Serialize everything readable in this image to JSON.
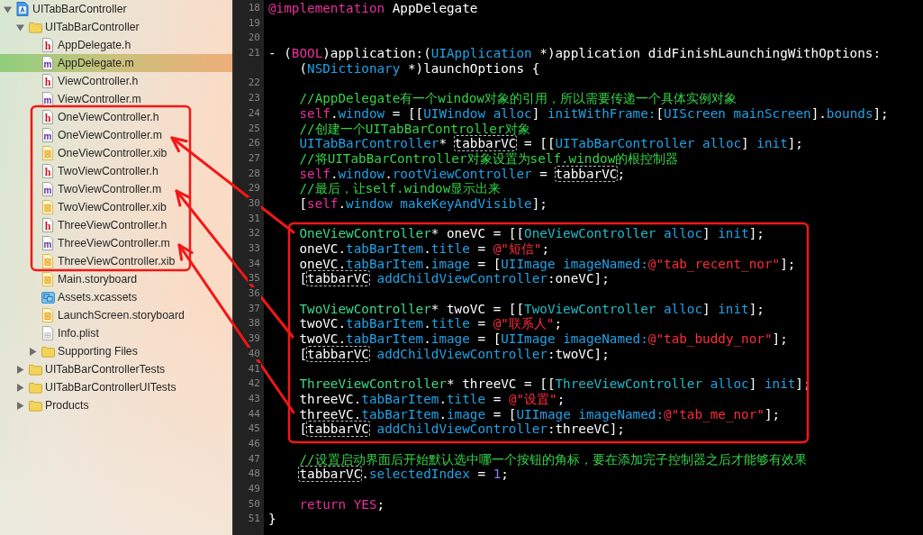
{
  "navigator": {
    "items": [
      {
        "name": "UITabBarController",
        "kind": "project",
        "expanded": true,
        "selected": false,
        "children": [
          {
            "name": "UITabBarController",
            "kind": "folder",
            "expanded": true,
            "selected": false,
            "children": [
              {
                "name": "AppDelegate.h",
                "kind": "header",
                "glyph": "h",
                "selected": false
              },
              {
                "name": "AppDelegate.m",
                "kind": "source",
                "glyph": "m",
                "selected": true
              },
              {
                "name": "ViewController.h",
                "kind": "header",
                "glyph": "h",
                "selected": false
              },
              {
                "name": "ViewController.m",
                "kind": "source",
                "glyph": "m",
                "selected": false
              },
              {
                "name": "OneViewController.h",
                "kind": "header",
                "glyph": "h",
                "selected": false
              },
              {
                "name": "OneViewController.m",
                "kind": "source",
                "glyph": "m",
                "selected": false
              },
              {
                "name": "OneViewController.xib",
                "kind": "interface",
                "selected": false
              },
              {
                "name": "TwoViewController.h",
                "kind": "header",
                "glyph": "h",
                "selected": false
              },
              {
                "name": "TwoViewController.m",
                "kind": "source",
                "glyph": "m",
                "selected": false
              },
              {
                "name": "TwoViewController.xib",
                "kind": "interface",
                "selected": false
              },
              {
                "name": "ThreeViewController.h",
                "kind": "header",
                "glyph": "h",
                "selected": false
              },
              {
                "name": "ThreeViewController.m",
                "kind": "source",
                "glyph": "m",
                "selected": false
              },
              {
                "name": "ThreeViewController.xib",
                "kind": "interface",
                "selected": false
              },
              {
                "name": "Main.storyboard",
                "kind": "interface",
                "selected": false
              },
              {
                "name": "Assets.xcassets",
                "kind": "assets",
                "selected": false
              },
              {
                "name": "LaunchScreen.storyboard",
                "kind": "interface",
                "selected": false
              },
              {
                "name": "Info.plist",
                "kind": "plist",
                "selected": false
              },
              {
                "name": "Supporting Files",
                "kind": "folder",
                "expanded": false,
                "selected": false
              }
            ]
          },
          {
            "name": "UITabBarControllerTests",
            "kind": "folder",
            "expanded": false,
            "selected": false
          },
          {
            "name": "UITabBarControllerUITests",
            "kind": "folder",
            "expanded": false,
            "selected": false
          },
          {
            "name": "Products",
            "kind": "folder",
            "expanded": false,
            "selected": false
          }
        ]
      }
    ]
  },
  "editor": {
    "lines": [
      {
        "number": "18",
        "segments": [
          {
            "text": "@implementation",
            "kind": "keyword"
          },
          {
            "text": " AppDelegate",
            "kind": "plain"
          }
        ]
      },
      {
        "number": "19"
      },
      {
        "number": "20"
      },
      {
        "number": "21",
        "segments": [
          {
            "text": "- (",
            "kind": "plain"
          },
          {
            "text": "BOOL",
            "kind": "keyword"
          },
          {
            "text": ")application:(",
            "kind": "plain"
          },
          {
            "text": "UIApplication",
            "kind": "api"
          },
          {
            "text": " *)application didFinishLaunchingWithOptions:",
            "kind": "plain"
          }
        ],
        "continuation": [
          {
            "text": "(",
            "kind": "plain"
          },
          {
            "text": "NSDictionary",
            "kind": "api"
          },
          {
            "text": " *)launchOptions {",
            "kind": "plain"
          }
        ]
      },
      {
        "number": "22"
      },
      {
        "number": "23",
        "segments": [
          {
            "text": "    //AppDelegate有一个window对象的引用，所以需要传递一个具体实例对象",
            "kind": "comment"
          }
        ]
      },
      {
        "number": "24",
        "segments": [
          {
            "text": "    self",
            "kind": "keyword"
          },
          {
            "text": ".",
            "kind": "plain"
          },
          {
            "text": "window",
            "kind": "api"
          },
          {
            "text": " = [[",
            "kind": "plain"
          },
          {
            "text": "UIWindow",
            "kind": "api"
          },
          {
            "text": " alloc",
            "kind": "api"
          },
          {
            "text": "] ",
            "kind": "plain"
          },
          {
            "text": "initWithFrame:",
            "kind": "api"
          },
          {
            "text": "[",
            "kind": "plain"
          },
          {
            "text": "UIScreen",
            "kind": "api"
          },
          {
            "text": " mainScreen",
            "kind": "api"
          },
          {
            "text": "].",
            "kind": "plain"
          },
          {
            "text": "bounds",
            "kind": "api"
          },
          {
            "text": "];",
            "kind": "plain"
          }
        ]
      },
      {
        "number": "25",
        "segments": [
          {
            "text": "    //创建一个UITabBarController对象",
            "kind": "comment"
          }
        ]
      },
      {
        "number": "26",
        "segments": [
          {
            "text": "    UITabBarController",
            "kind": "api"
          },
          {
            "text": "* ",
            "kind": "plain"
          },
          {
            "text": "tabbarVC",
            "kind": "occurrence"
          },
          {
            "text": " = [[",
            "kind": "plain"
          },
          {
            "text": "UITabBarController",
            "kind": "api"
          },
          {
            "text": " alloc",
            "kind": "api"
          },
          {
            "text": "] ",
            "kind": "plain"
          },
          {
            "text": "init",
            "kind": "api"
          },
          {
            "text": "];",
            "kind": "plain"
          }
        ]
      },
      {
        "number": "27",
        "segments": [
          {
            "text": "    //将UITabBarController对象设置为self.window的根控制器",
            "kind": "comment"
          }
        ]
      },
      {
        "number": "28",
        "segments": [
          {
            "text": "    self",
            "kind": "keyword"
          },
          {
            "text": ".",
            "kind": "plain"
          },
          {
            "text": "window",
            "kind": "api"
          },
          {
            "text": ".",
            "kind": "plain"
          },
          {
            "text": "rootViewController",
            "kind": "api"
          },
          {
            "text": " = ",
            "kind": "plain"
          },
          {
            "text": "tabbarVC",
            "kind": "occurrence"
          },
          {
            "text": ";",
            "kind": "plain"
          }
        ]
      },
      {
        "number": "29",
        "segments": [
          {
            "text": "    //最后，让self.window显示出来",
            "kind": "comment"
          }
        ]
      },
      {
        "number": "30",
        "segments": [
          {
            "text": "    [",
            "kind": "plain"
          },
          {
            "text": "self",
            "kind": "keyword"
          },
          {
            "text": ".",
            "kind": "plain"
          },
          {
            "text": "window",
            "kind": "api"
          },
          {
            "text": " makeKeyAndVisible",
            "kind": "api"
          },
          {
            "text": "];",
            "kind": "plain"
          }
        ]
      },
      {
        "number": "31"
      },
      {
        "number": "32",
        "segments": [
          {
            "text": "    OneViewController",
            "kind": "project"
          },
          {
            "text": "* oneVC = [[",
            "kind": "plain"
          },
          {
            "text": "OneViewController",
            "kind": "project_ref"
          },
          {
            "text": " alloc",
            "kind": "api"
          },
          {
            "text": "] ",
            "kind": "plain"
          },
          {
            "text": "init",
            "kind": "api"
          },
          {
            "text": "];",
            "kind": "plain"
          }
        ]
      },
      {
        "number": "33",
        "segments": [
          {
            "text": "    oneVC.",
            "kind": "plain"
          },
          {
            "text": "tabBarItem",
            "kind": "api"
          },
          {
            "text": ".",
            "kind": "plain"
          },
          {
            "text": "title",
            "kind": "api"
          },
          {
            "text": " = ",
            "kind": "plain"
          },
          {
            "text": "@\"短信\"",
            "kind": "string"
          },
          {
            "text": ";",
            "kind": "plain"
          }
        ]
      },
      {
        "number": "34",
        "segments": [
          {
            "text": "    oneVC.",
            "kind": "plain"
          },
          {
            "text": "tabBarItem",
            "kind": "api"
          },
          {
            "text": ".",
            "kind": "plain"
          },
          {
            "text": "image",
            "kind": "api"
          },
          {
            "text": " = [",
            "kind": "plain"
          },
          {
            "text": "UIImage",
            "kind": "api"
          },
          {
            "text": " imageNamed:",
            "kind": "api"
          },
          {
            "text": "@\"tab_recent_nor\"",
            "kind": "string"
          },
          {
            "text": "];",
            "kind": "plain"
          }
        ]
      },
      {
        "number": "35",
        "segments": [
          {
            "text": "    [",
            "kind": "plain"
          },
          {
            "text": "tabbarVC",
            "kind": "occurrence"
          },
          {
            "text": " addChildViewController",
            "kind": "api"
          },
          {
            "text": ":oneVC];",
            "kind": "plain"
          }
        ]
      },
      {
        "number": "36"
      },
      {
        "number": "37",
        "segments": [
          {
            "text": "    TwoViewController",
            "kind": "project"
          },
          {
            "text": "* twoVC = [[",
            "kind": "plain"
          },
          {
            "text": "TwoViewController",
            "kind": "project_ref"
          },
          {
            "text": " alloc",
            "kind": "api"
          },
          {
            "text": "] ",
            "kind": "plain"
          },
          {
            "text": "init",
            "kind": "api"
          },
          {
            "text": "];",
            "kind": "plain"
          }
        ]
      },
      {
        "number": "38",
        "segments": [
          {
            "text": "    twoVC.",
            "kind": "plain"
          },
          {
            "text": "tabBarItem",
            "kind": "api"
          },
          {
            "text": ".",
            "kind": "plain"
          },
          {
            "text": "title",
            "kind": "api"
          },
          {
            "text": " = ",
            "kind": "plain"
          },
          {
            "text": "@\"联系人\"",
            "kind": "string"
          },
          {
            "text": ";",
            "kind": "plain"
          }
        ]
      },
      {
        "number": "39",
        "segments": [
          {
            "text": "    twoVC.",
            "kind": "plain"
          },
          {
            "text": "tabBarItem",
            "kind": "api"
          },
          {
            "text": ".",
            "kind": "plain"
          },
          {
            "text": "image",
            "kind": "api"
          },
          {
            "text": " = [",
            "kind": "plain"
          },
          {
            "text": "UIImage",
            "kind": "api"
          },
          {
            "text": " imageNamed:",
            "kind": "api"
          },
          {
            "text": "@\"tab_buddy_nor\"",
            "kind": "string"
          },
          {
            "text": "];",
            "kind": "plain"
          }
        ]
      },
      {
        "number": "40",
        "segments": [
          {
            "text": "    [",
            "kind": "plain"
          },
          {
            "text": "tabbarVC",
            "kind": "occurrence"
          },
          {
            "text": " addChildViewController",
            "kind": "api"
          },
          {
            "text": ":twoVC];",
            "kind": "plain"
          }
        ]
      },
      {
        "number": "41"
      },
      {
        "number": "42",
        "segments": [
          {
            "text": "    ThreeViewController",
            "kind": "project"
          },
          {
            "text": "* threeVC = [[",
            "kind": "plain"
          },
          {
            "text": "ThreeViewController",
            "kind": "project_ref"
          },
          {
            "text": " alloc",
            "kind": "api"
          },
          {
            "text": "] ",
            "kind": "plain"
          },
          {
            "text": "init",
            "kind": "api"
          },
          {
            "text": "];",
            "kind": "plain"
          }
        ]
      },
      {
        "number": "43",
        "segments": [
          {
            "text": "    threeVC.",
            "kind": "plain"
          },
          {
            "text": "tabBarItem",
            "kind": "api"
          },
          {
            "text": ".",
            "kind": "plain"
          },
          {
            "text": "title",
            "kind": "api"
          },
          {
            "text": " = ",
            "kind": "plain"
          },
          {
            "text": "@\"设置\"",
            "kind": "string"
          },
          {
            "text": ";",
            "kind": "plain"
          }
        ]
      },
      {
        "number": "44",
        "segments": [
          {
            "text": "    threeVC.",
            "kind": "plain"
          },
          {
            "text": "tabBarItem",
            "kind": "api"
          },
          {
            "text": ".",
            "kind": "plain"
          },
          {
            "text": "image",
            "kind": "api"
          },
          {
            "text": " = [",
            "kind": "plain"
          },
          {
            "text": "UIImage",
            "kind": "api"
          },
          {
            "text": " imageNamed:",
            "kind": "api"
          },
          {
            "text": "@\"tab_me_nor\"",
            "kind": "string"
          },
          {
            "text": "];",
            "kind": "plain"
          }
        ]
      },
      {
        "number": "45",
        "segments": [
          {
            "text": "    [",
            "kind": "plain"
          },
          {
            "text": "tabbarVC",
            "kind": "occurrence"
          },
          {
            "text": " addChildViewController",
            "kind": "api"
          },
          {
            "text": ":threeVC];",
            "kind": "plain"
          }
        ]
      },
      {
        "number": "46"
      },
      {
        "number": "47",
        "segments": [
          {
            "text": "    //设置启动界面后开始默认选中哪一个按钮的角标，要在添加完子控制器之后才能够有效果",
            "kind": "comment"
          }
        ]
      },
      {
        "number": "48",
        "segments": [
          {
            "text": "    tabbarVC",
            "kind": "occurrence"
          },
          {
            "text": ".",
            "kind": "plain"
          },
          {
            "text": "selectedIndex",
            "kind": "api"
          },
          {
            "text": " = ",
            "kind": "plain"
          },
          {
            "text": "1",
            "kind": "number"
          },
          {
            "text": ";",
            "kind": "plain"
          }
        ]
      },
      {
        "number": "49"
      },
      {
        "number": "50",
        "segments": [
          {
            "text": "    return",
            "kind": "keyword"
          },
          {
            "text": " YES",
            "kind": "keyword"
          },
          {
            "text": ";",
            "kind": "plain"
          }
        ]
      },
      {
        "number": "51",
        "segments": [
          {
            "text": "}",
            "kind": "plain"
          }
        ]
      }
    ]
  },
  "annotations": [
    {
      "kind": "frame"
    },
    {
      "kind": "frame"
    },
    {
      "kind": "arrow"
    },
    {
      "kind": "arrow"
    },
    {
      "kind": "arrow"
    }
  ]
}
